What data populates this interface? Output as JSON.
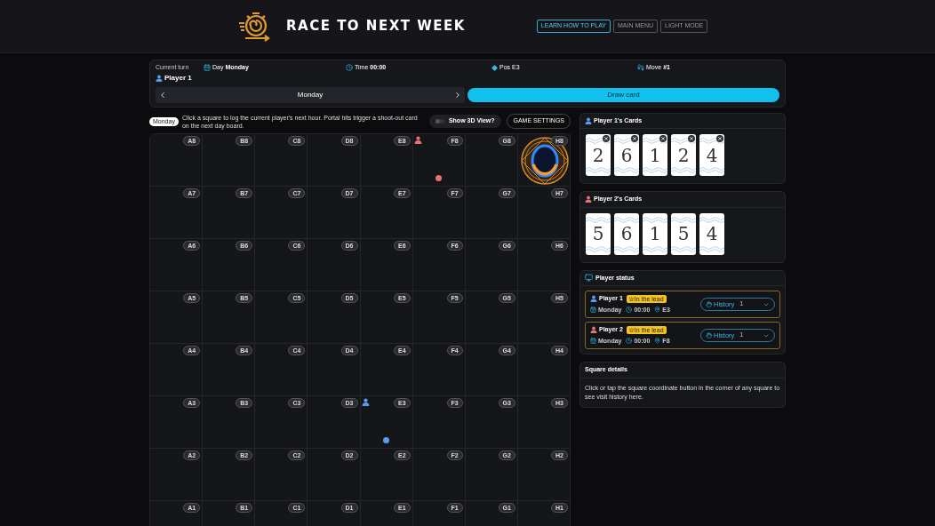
{
  "header": {
    "title": "RACE TO NEXT WEEK",
    "nav": [
      {
        "label": "LEARN HOW TO PLAY",
        "selected": true
      },
      {
        "label": "MAIN MENU",
        "selected": false
      },
      {
        "label": "LIGHT MODE",
        "selected": false
      }
    ]
  },
  "turn": {
    "caption": "Current turn",
    "player": "Player 1",
    "color": "#5b9bef",
    "day_label": "Day",
    "day": "Monday",
    "time_label": "Time",
    "time": "00:00",
    "pos": "Pos E3",
    "move_label": "Move",
    "move": "#1",
    "day_selector": "Monday",
    "draw_button": "Draw card"
  },
  "hint": {
    "badge": "Monday",
    "text": "Click a square to log the current player's next hour. Portal hits trigger a shoot-out card on the next day board."
  },
  "toggle_3d": {
    "label": "Show 3D View?",
    "on": false
  },
  "settings_button": "GAME SETTINGS",
  "board": {
    "rows": [
      [
        "A8",
        "B8",
        "C8",
        "D8",
        "E8",
        {
          "label": "F8",
          "kind": "token",
          "color": "#e57373"
        },
        "G8",
        {
          "label": "H8",
          "kind": "portal"
        }
      ],
      [
        "A7",
        "B7",
        "C7",
        "D7",
        "E7",
        "F7",
        "G7",
        "H7"
      ],
      [
        "A6",
        "B6",
        "C6",
        "D6",
        "E6",
        "F6",
        "G6",
        "H6"
      ],
      [
        "A5",
        "B5",
        "C5",
        "D5",
        "E5",
        "F5",
        "G5",
        "H5"
      ],
      [
        "A4",
        "B4",
        "C4",
        "D4",
        "E4",
        "F4",
        "G4",
        "H4"
      ],
      [
        "A3",
        "B3",
        "C3",
        "D3",
        {
          "label": "E3",
          "kind": "token",
          "color": "#5b9bef"
        },
        "F3",
        "G3",
        "H3"
      ],
      [
        "A2",
        "B2",
        "C2",
        "D2",
        "E2",
        "F2",
        "G2",
        "H2"
      ],
      [
        "A1",
        "B1",
        "C1",
        "D1",
        "E1",
        "F1",
        "G1",
        "H1"
      ]
    ]
  },
  "hands": [
    {
      "title": "Player 1's Cards",
      "color": "#5b9bef",
      "removable": true,
      "cards": [
        "2",
        "6",
        "1",
        "2",
        "4"
      ]
    },
    {
      "title": "Player 2's Cards",
      "color": "#e57373",
      "removable": false,
      "cards": [
        "5",
        "6",
        "1",
        "5",
        "4"
      ]
    }
  ],
  "status": {
    "title": "Player status",
    "players": [
      {
        "name": "Player 1",
        "color": "#5b9bef",
        "badge": "In the lead",
        "day": "Monday",
        "time": "00:00",
        "pos": "E3",
        "history": "History",
        "count": "1",
        "expanded": false
      },
      {
        "name": "Player 2",
        "color": "#e57373",
        "badge": "In the lead",
        "day": "Monday",
        "time": "00:00",
        "pos": "F8",
        "history": "History",
        "count": "1",
        "expanded": false
      }
    ]
  },
  "square_details": {
    "title": "Square details",
    "text": "Click or tap the square coordinate button in the corner of any square to see visit history here."
  }
}
